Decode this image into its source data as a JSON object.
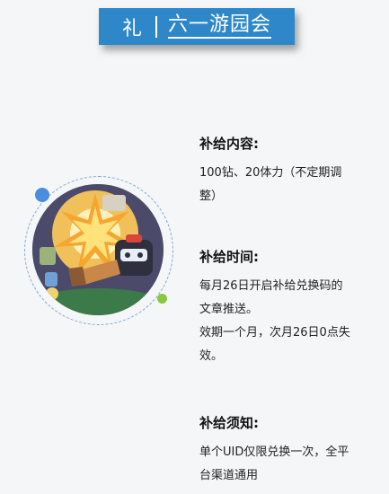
{
  "header": {
    "tag": "礼",
    "title": "六一游园会"
  },
  "colors": {
    "banner": "#2e87c9",
    "dot_blue": "#4a8de0",
    "dot_green": "#86c940",
    "ring": "#7fa7d6"
  },
  "sections": [
    {
      "title": "补给内容:",
      "text": "100钻、20体力（不定期调\n整）"
    },
    {
      "title": "补给时间:",
      "text": "每月26日开启补给兑换码的\n文章推送。\n效期一个月，次月26日0点失\n效。"
    },
    {
      "title": "补给须知:",
      "text": "单个UID仅限兑换一次，全平\n台渠道通用"
    }
  ]
}
